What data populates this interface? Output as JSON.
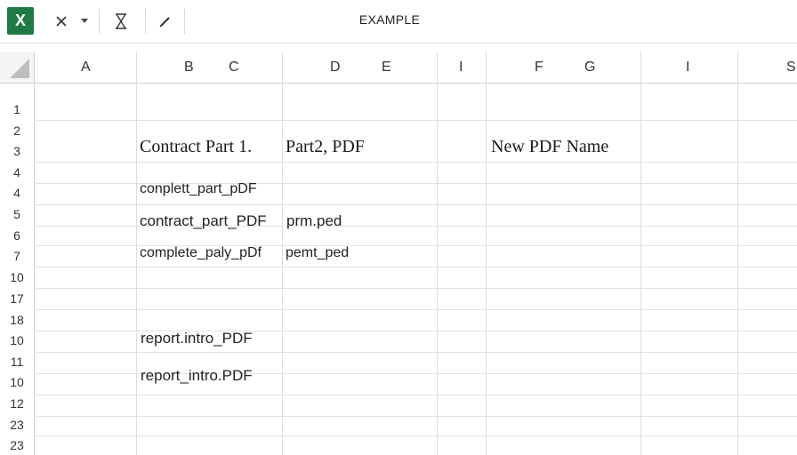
{
  "app": {
    "title": "EXAMPLE",
    "logo_letter": "X",
    "colors": {
      "brand": "#1f7a45",
      "grid": "#dcdcdc",
      "header_bg": "#f5f5f5"
    }
  },
  "toolbar": {
    "icons": [
      "excel-logo-icon",
      "close-icon",
      "dropdown-arrow-icon",
      "hourglass-icon",
      "pen-icon"
    ]
  },
  "columns": [
    "A",
    "B",
    "C",
    "D",
    "E",
    "I",
    "F",
    "G",
    "I",
    "S"
  ],
  "rows": [
    "1",
    "2",
    "3",
    "4",
    "4",
    "5",
    "6",
    "7",
    "10",
    "17",
    "18",
    "10",
    "11",
    "10",
    "12",
    "23",
    "23"
  ],
  "cells": {
    "contract_part1": "Contract Part 1.",
    "part2_pdf": "Part2, PDF",
    "new_pdf_name": "New PDF Name",
    "conplett_part": "conplett_part_pDF",
    "contract_part": "contract_part_PDF",
    "prm_ped": "prm.ped",
    "complete_paly": "complete_paly_pDf",
    "pemt_ped": "pemt_ped",
    "report_intro_1": "report.intro_PDF",
    "report_intro_2": "report_intro.PDF"
  }
}
